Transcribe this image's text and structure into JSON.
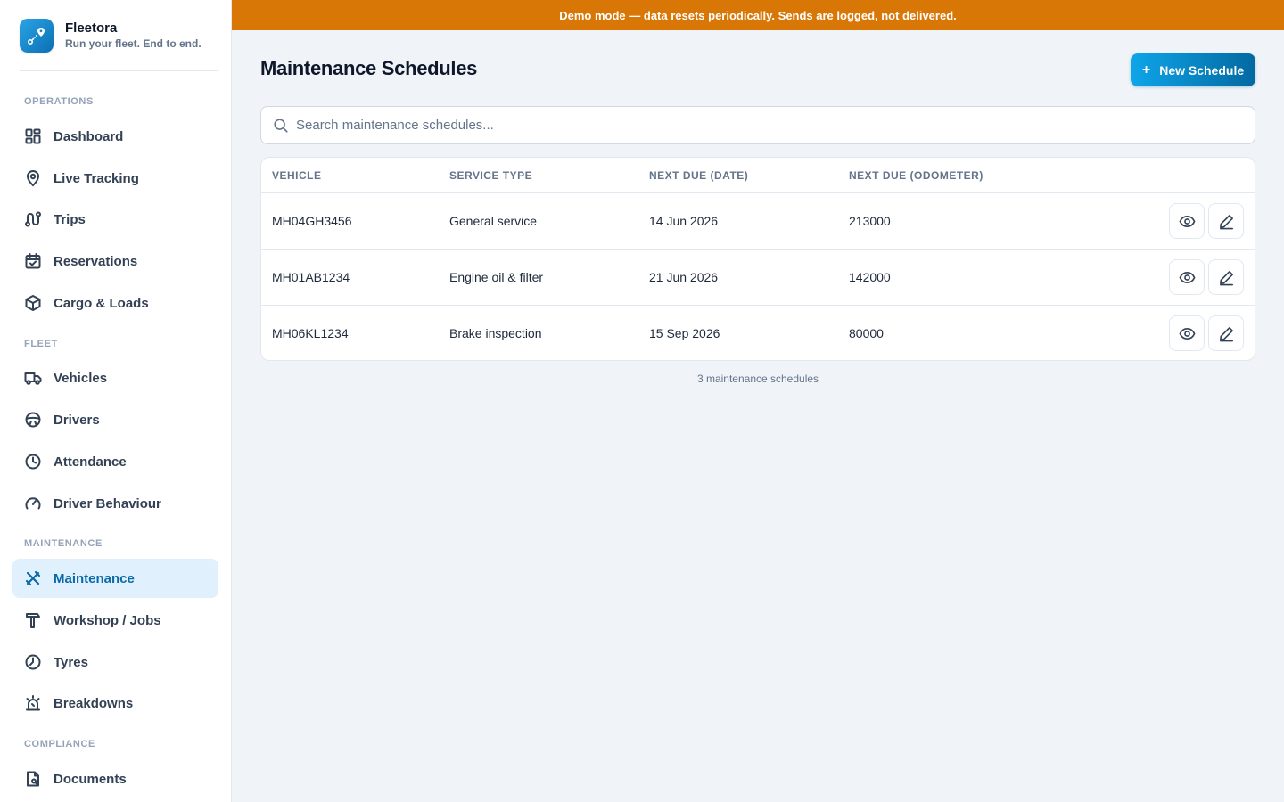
{
  "brand": {
    "name": "Fleetora",
    "tagline": "Run your fleet. End to end."
  },
  "banner": {
    "text": "Demo mode — data resets periodically. Sends are logged, not delivered."
  },
  "sidebar": {
    "sections": [
      {
        "label": "OPERATIONS"
      },
      {
        "label": "FLEET"
      },
      {
        "label": "MAINTENANCE"
      },
      {
        "label": "COMPLIANCE"
      }
    ],
    "items": [
      {
        "label": "Dashboard",
        "icon": "dashboard-icon"
      },
      {
        "label": "Live Tracking",
        "icon": "map-pin-icon"
      },
      {
        "label": "Trips",
        "icon": "route-icon"
      },
      {
        "label": "Reservations",
        "icon": "calendar-check-icon"
      },
      {
        "label": "Cargo & Loads",
        "icon": "box-icon"
      },
      {
        "label": "Vehicles",
        "icon": "truck-icon"
      },
      {
        "label": "Drivers",
        "icon": "steering-wheel-icon"
      },
      {
        "label": "Attendance",
        "icon": "clock-icon"
      },
      {
        "label": "Driver Behaviour",
        "icon": "gauge-icon"
      },
      {
        "label": "Maintenance",
        "icon": "wrench-cross-icon",
        "active": true
      },
      {
        "label": "Workshop / Jobs",
        "icon": "hammer-icon"
      },
      {
        "label": "Tyres",
        "icon": "tyre-icon"
      },
      {
        "label": "Breakdowns",
        "icon": "siren-icon"
      },
      {
        "label": "Documents",
        "icon": "document-icon"
      }
    ]
  },
  "main": {
    "title": "Maintenance Schedules",
    "new_button": "New Schedule",
    "search_placeholder": "Search maintenance schedules...",
    "columns": [
      "VEHICLE",
      "SERVICE TYPE",
      "NEXT DUE (DATE)",
      "NEXT DUE (ODOMETER)"
    ],
    "rows": [
      {
        "vehicle": "MH04GH3456",
        "service": "General service",
        "date": "14 Jun 2026",
        "odometer": "213000"
      },
      {
        "vehicle": "MH01AB1234",
        "service": "Engine oil & filter",
        "date": "21 Jun 2026",
        "odometer": "142000"
      },
      {
        "vehicle": "MH06KL1234",
        "service": "Brake inspection",
        "date": "15 Sep 2026",
        "odometer": "80000"
      }
    ],
    "count_text": "3 maintenance schedules"
  },
  "colors": {
    "accent": "#0a6aa8",
    "banner": "#d97706",
    "active_bg": "#e0f0fc"
  }
}
